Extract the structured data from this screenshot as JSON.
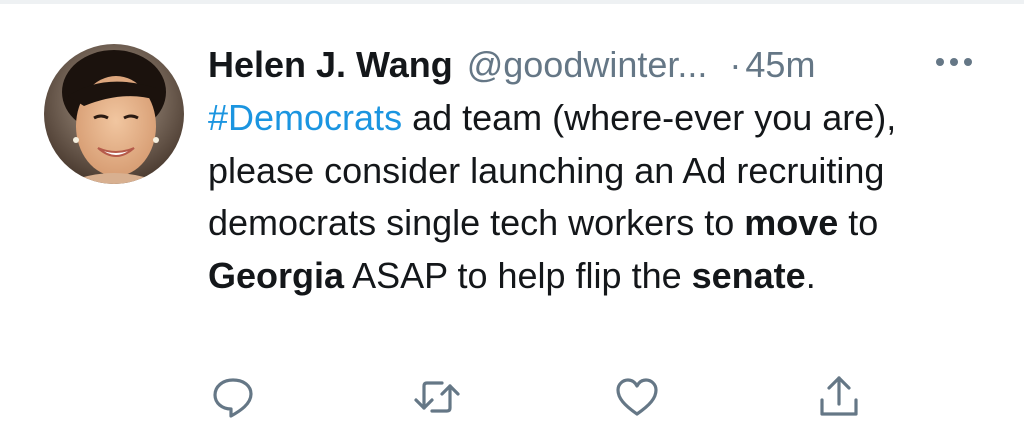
{
  "tweet": {
    "author": {
      "display_name": "Helen J. Wang",
      "handle": "@goodwinter...",
      "avatar_icon": "avatar-photo"
    },
    "separator": "·",
    "time": "45m",
    "more_icon": "more-icon",
    "text": {
      "hashtag": "#Democrats",
      "part1": " ad team (where-ever you are), please consider launching an Ad recruiting democrats single tech workers to ",
      "bold1": "move",
      "part2": " to ",
      "bold2": "Georgia",
      "part3": " ASAP to help flip the ",
      "bold3": "senate",
      "part4": "."
    },
    "actions": [
      {
        "icon": "reply-icon"
      },
      {
        "icon": "retweet-icon"
      },
      {
        "icon": "like-icon"
      },
      {
        "icon": "share-icon"
      }
    ]
  },
  "colors": {
    "hashtag": "#1b95e0",
    "secondary_text": "#657786",
    "primary_text": "#14171a",
    "icon": "#657786"
  }
}
